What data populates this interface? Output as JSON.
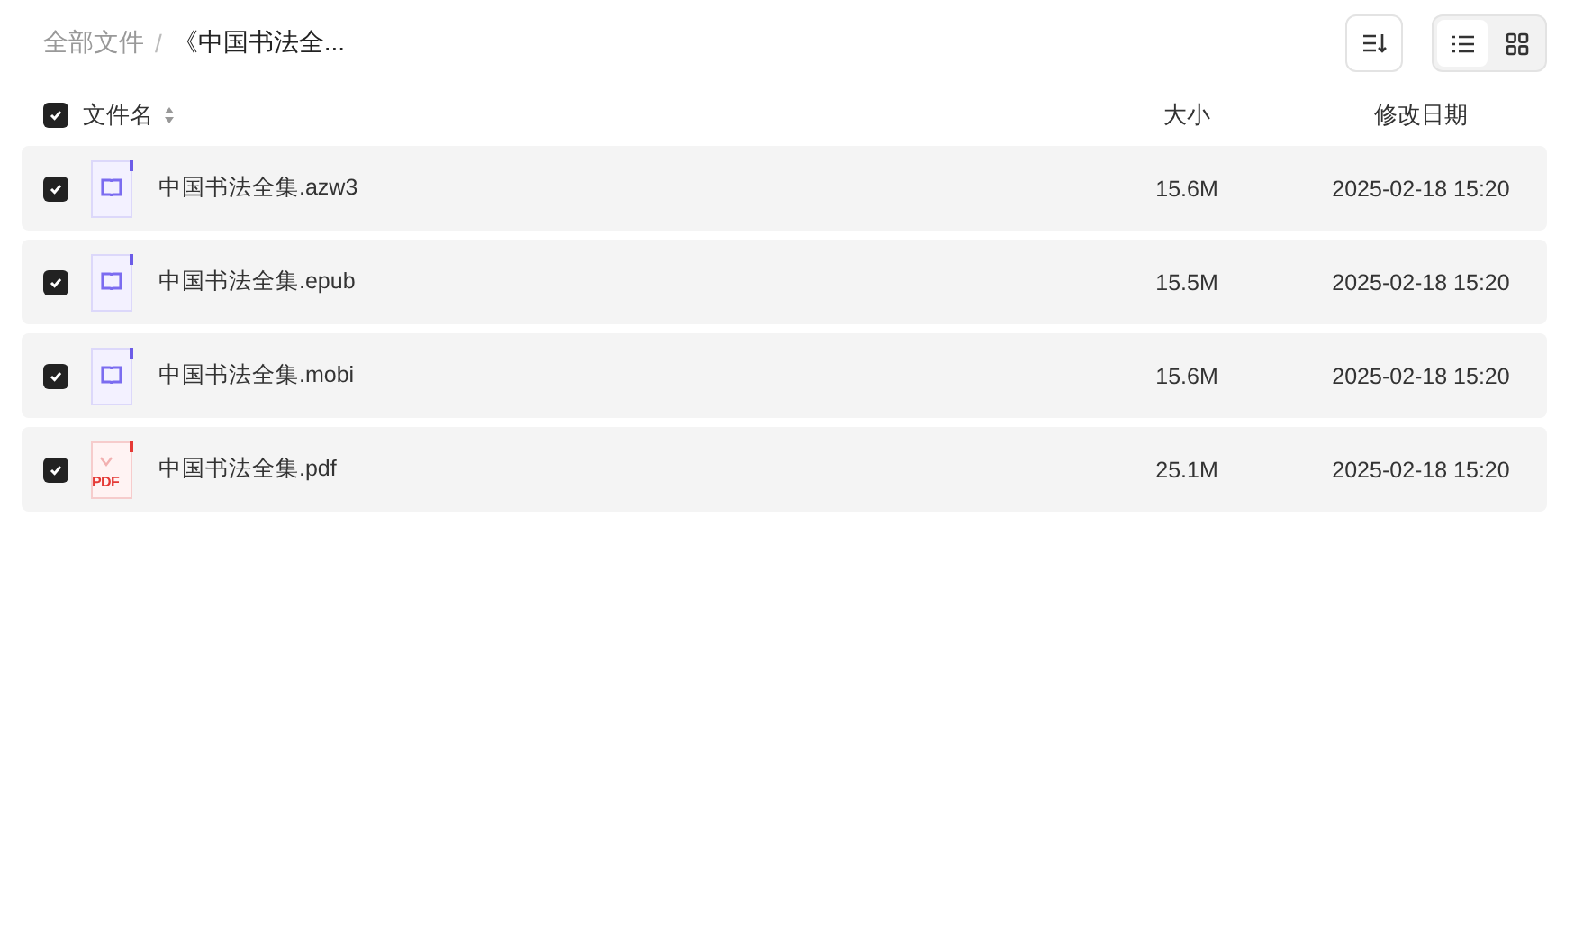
{
  "breadcrumb": [
    {
      "label": "全部文件"
    },
    {
      "label": "《中国书法全..."
    }
  ],
  "separator": "/",
  "view_toggle": [
    {
      "kind": "list",
      "selected": true
    },
    {
      "kind": "grid",
      "selected": false
    }
  ],
  "table": {
    "select_all_checked": true,
    "columns": [
      "文件名",
      "大小",
      "修改日期"
    ],
    "rows": [
      {
        "name": "中国书法全集.azw3",
        "kind": "ebook",
        "size": "15.6M",
        "date": "2025-02-18 15:20",
        "checked": true
      },
      {
        "name": "中国书法全集.epub",
        "kind": "ebook",
        "size": "15.5M",
        "date": "2025-02-18 15:20",
        "checked": true
      },
      {
        "name": "中国书法全集.mobi",
        "kind": "ebook",
        "size": "15.6M",
        "date": "2025-02-18 15:20",
        "checked": true
      },
      {
        "name": "中国书法全集.pdf",
        "kind": "pdf",
        "icon_label": "PDF",
        "size": "25.1M",
        "date": "2025-02-18 15:20",
        "checked": true
      }
    ]
  }
}
